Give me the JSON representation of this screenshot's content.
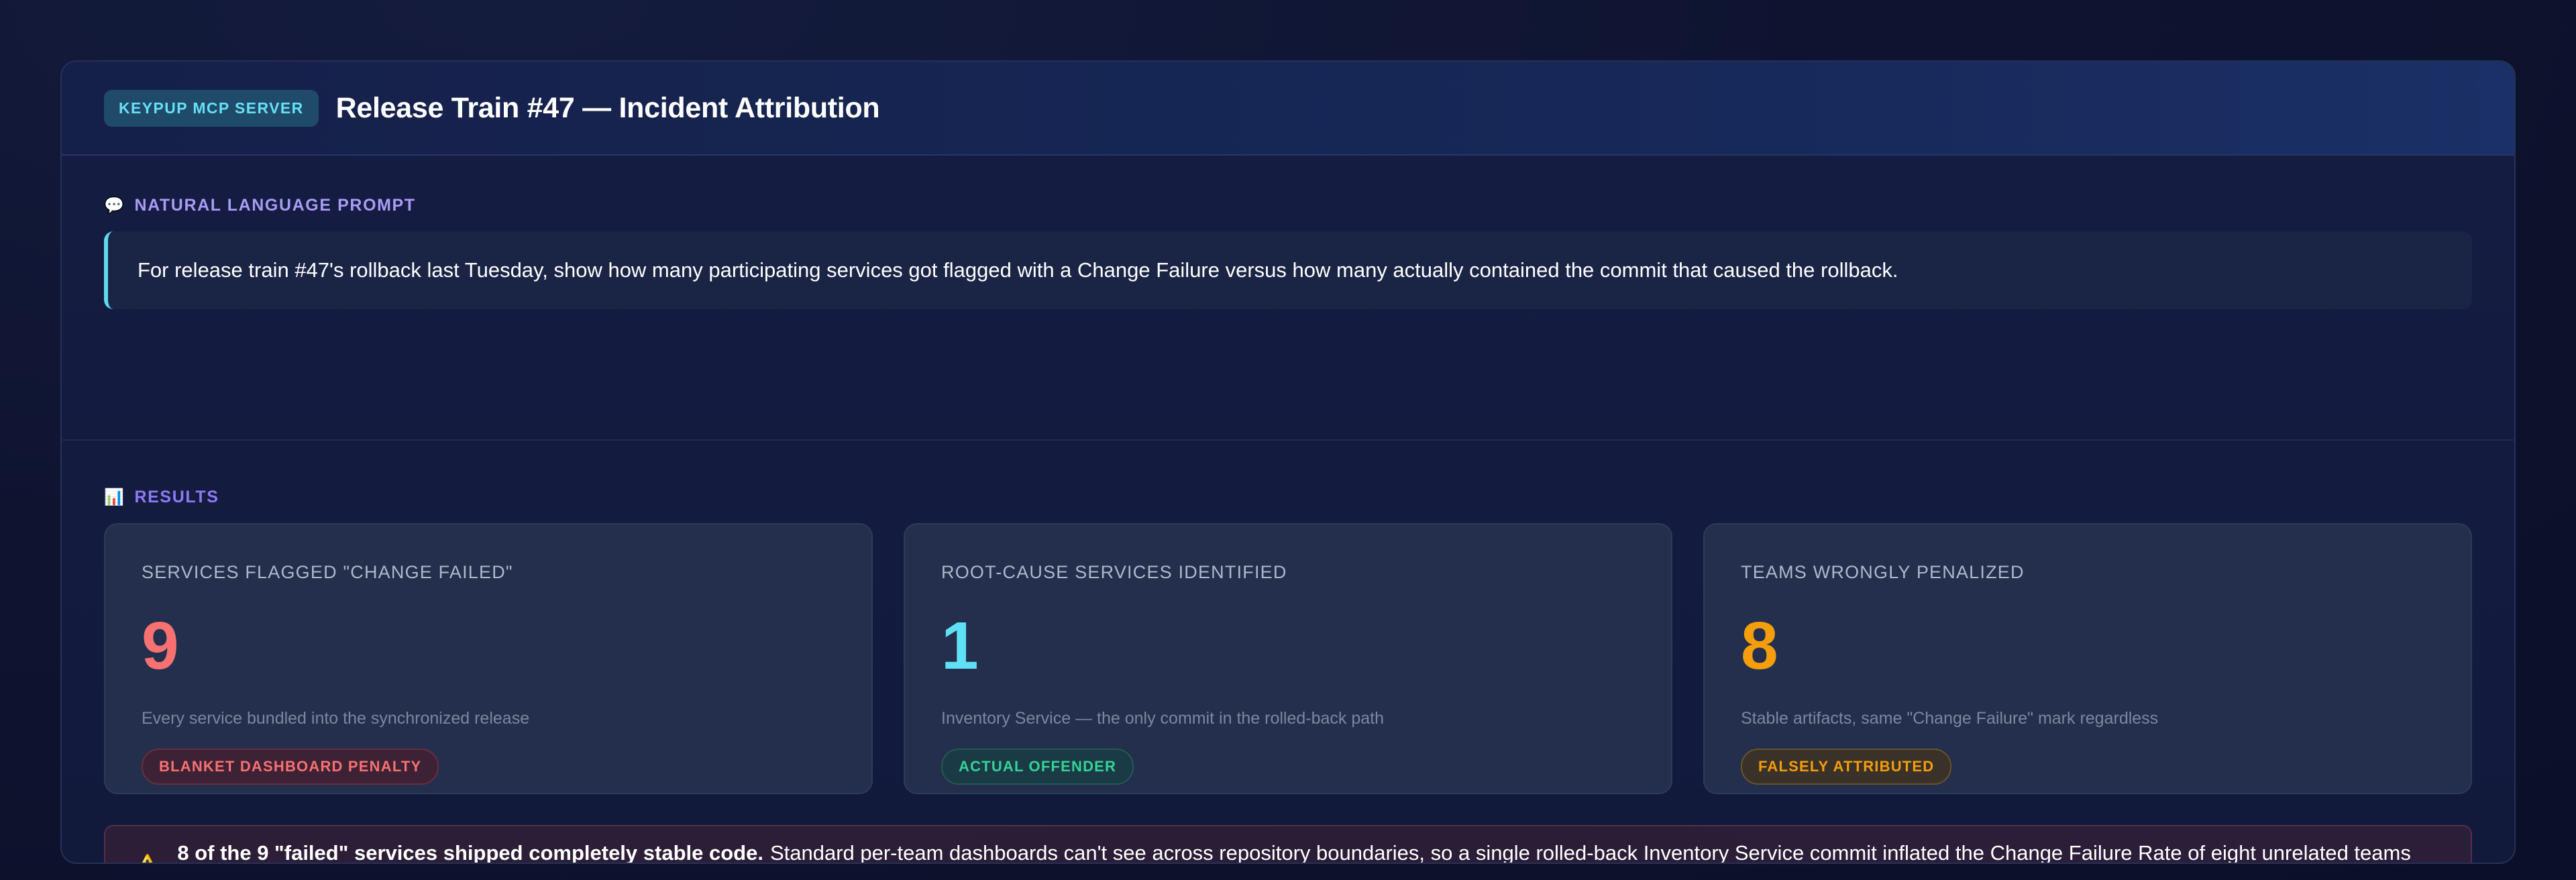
{
  "header": {
    "badge": "KEYPUP MCP SERVER",
    "title": "Release Train #47 — Incident Attribution"
  },
  "prompt": {
    "icon": "speech-bubble-icon",
    "label": "NATURAL LANGUAGE PROMPT",
    "text": "For release train #47's rollback last Tuesday, show how many participating services got flagged with a Change Failure versus how many actually contained the commit that caused the rollback."
  },
  "results": {
    "icon": "bar-chart-icon",
    "label": "RESULTS",
    "cards": [
      {
        "title": "SERVICES FLAGGED \"CHANGE FAILED\"",
        "value": "9",
        "description": "Every service bundled into the synchronized release",
        "tag": "BLANKET DASHBOARD PENALTY",
        "color": "#f87171"
      },
      {
        "title": "ROOT-CAUSE SERVICES IDENTIFIED",
        "value": "1",
        "description": "Inventory Service — the only commit in the rolled-back path",
        "tag": "ACTUAL OFFENDER",
        "color": "#5ee0f5"
      },
      {
        "title": "TEAMS WRONGLY PENALIZED",
        "value": "8",
        "description": "Stable artifacts, same \"Change Failure\" mark regardless",
        "tag": "FALSELY ATTRIBUTED",
        "color": "#f59e0b"
      }
    ]
  },
  "warning": {
    "icon": "warning-icon",
    "bold": "8 of the 9 \"failed\" services shipped completely stable code.",
    "text": "Standard per-team dashboards can't see across repository boundaries, so a single rolled-back Inventory Service commit inflated the Change Failure Rate of eight unrelated teams overnight."
  }
}
